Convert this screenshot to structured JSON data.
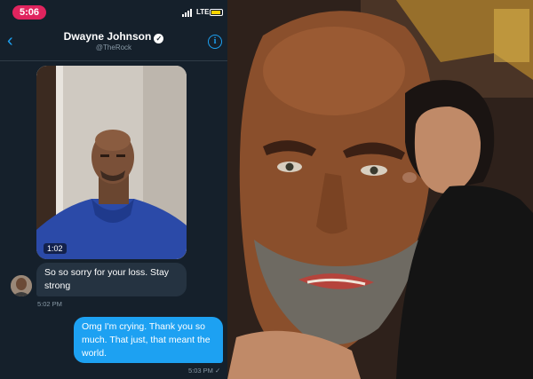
{
  "status_bar": {
    "time": "5:06",
    "network": "LTE",
    "accent_color": "#e0245e",
    "battery_color": "#ffd400"
  },
  "conversation": {
    "name": "Dwayne Johnson",
    "handle": "@TheRock",
    "verified": true,
    "icons": [
      "back-chevron-icon",
      "verified-badge-icon",
      "info-icon"
    ],
    "background_color": "#15202b",
    "link_color": "#1da1f2"
  },
  "messages": [
    {
      "type": "video",
      "direction": "incoming",
      "duration": "1:02"
    },
    {
      "type": "text",
      "direction": "incoming",
      "text": "So so sorry for your loss. Stay strong",
      "time": "5:02 PM",
      "bubble_color": "#253341"
    },
    {
      "type": "text",
      "direction": "outgoing",
      "text": "Omg I'm crying. Thank you so much. That just, that meant the world.",
      "time": "5:03 PM",
      "bubble_color": "#1da1f2"
    }
  ]
}
